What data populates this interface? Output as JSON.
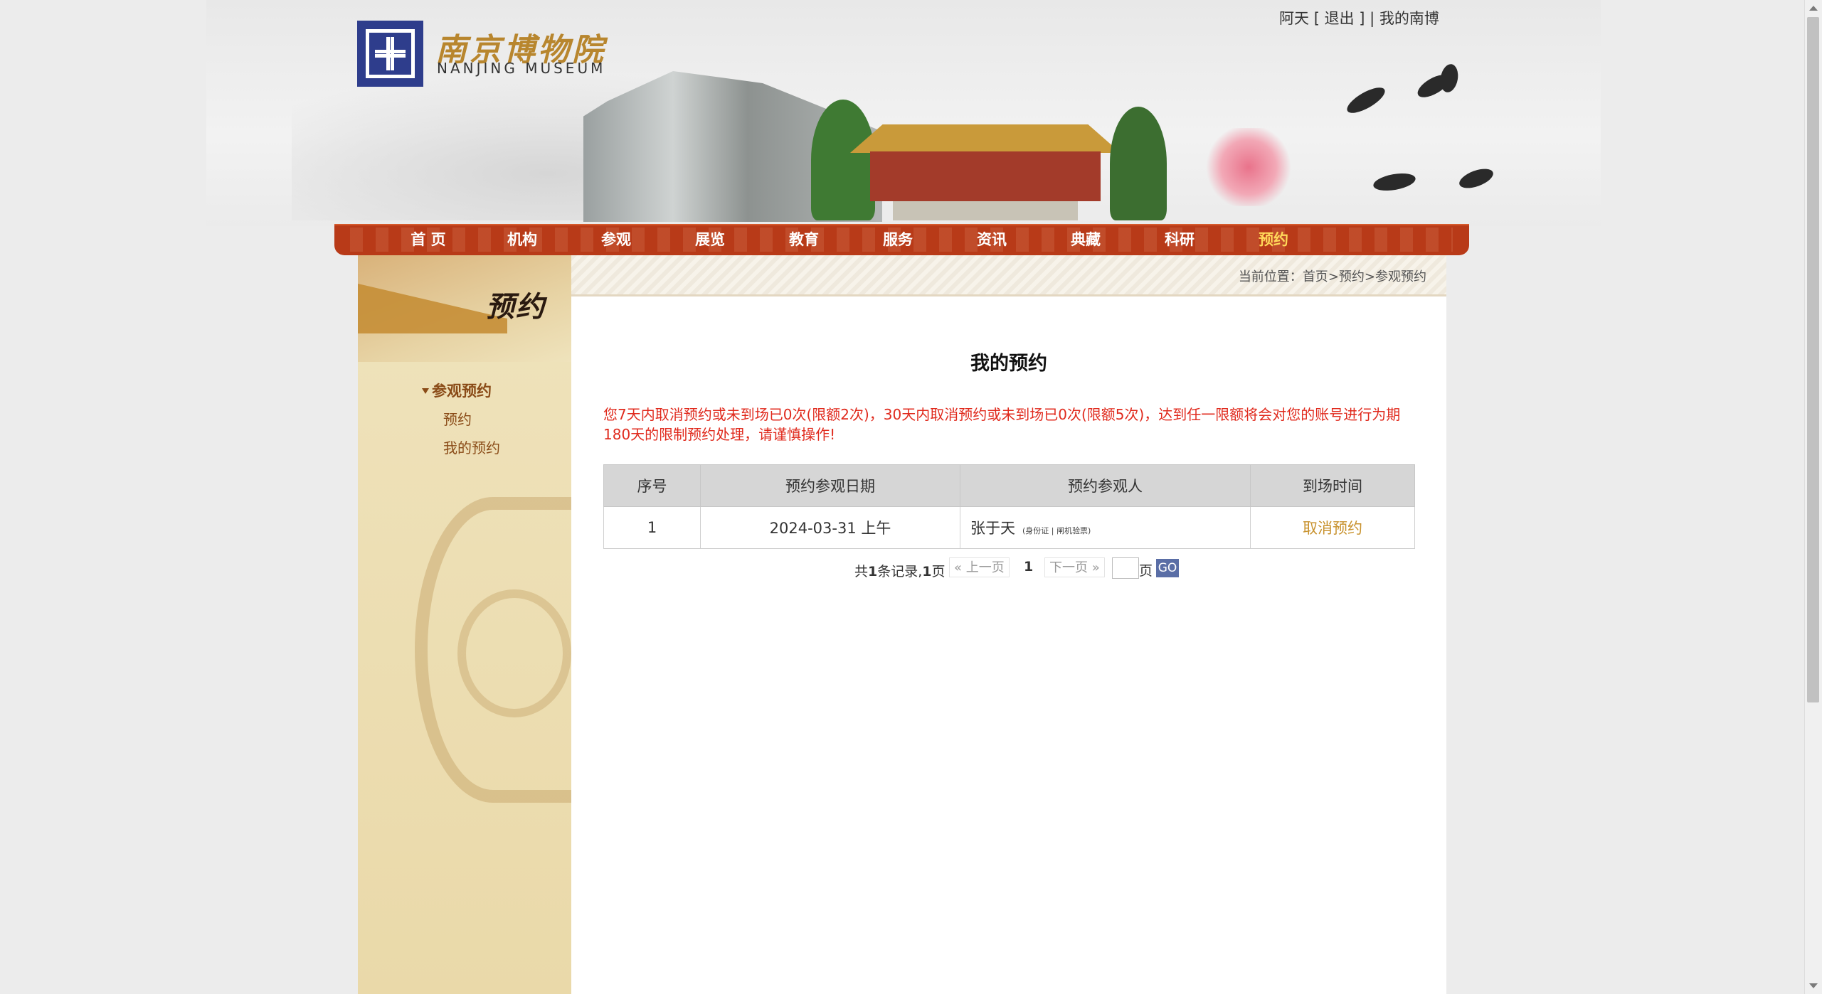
{
  "header": {
    "logo_cn": "南京博物院",
    "logo_en": "NANJING MUSEUM",
    "user_name": "阿天",
    "logout_link": "[ 退出 ]",
    "separator": "|",
    "my_museum_link": "我的南博"
  },
  "nav": {
    "items": [
      {
        "label": "首 页"
      },
      {
        "label": "机构"
      },
      {
        "label": "参观"
      },
      {
        "label": "展览"
      },
      {
        "label": "教育"
      },
      {
        "label": "服务"
      },
      {
        "label": "资讯"
      },
      {
        "label": "典藏"
      },
      {
        "label": "科研"
      },
      {
        "label": "预约"
      }
    ],
    "active": "预约",
    "active_color": "#ffd85a",
    "bar_color": "#b83a18"
  },
  "sidebar": {
    "section_title": "预约",
    "group_label": "参观预约",
    "items": [
      {
        "label": "预约"
      },
      {
        "label": "我的预约"
      }
    ]
  },
  "breadcrumb": {
    "prefix": "当前位置：",
    "home": "首页",
    "sep": ">",
    "level1": "预约",
    "level2": "参观预约"
  },
  "main": {
    "title": "我的预约",
    "notice": "您7天内取消预约或未到场已0次(限额2次)，30天内取消预约或未到场已0次(限额5次)，达到任一限额将会对您的账号进行为期180天的限制预约处理，请谨慎操作!",
    "notice_color": "#e02a1d",
    "table": {
      "headers": [
        "序号",
        "预约参观日期",
        "预约参观人",
        "到场时间"
      ],
      "rows": [
        {
          "no": "1",
          "date": "2024-03-31 上午",
          "person": "张于天",
          "person_note": "(身份证 | 闸机验票)",
          "action": "取消预约"
        }
      ]
    },
    "pager": {
      "total_prefix": "共",
      "total_records": "1",
      "records_label": "条记录,",
      "total_pages": "1",
      "pages_label": "页",
      "prev": "« 上一页",
      "current": "1",
      "next": "下一页 »",
      "page_unit": "页",
      "go": "GO"
    }
  }
}
